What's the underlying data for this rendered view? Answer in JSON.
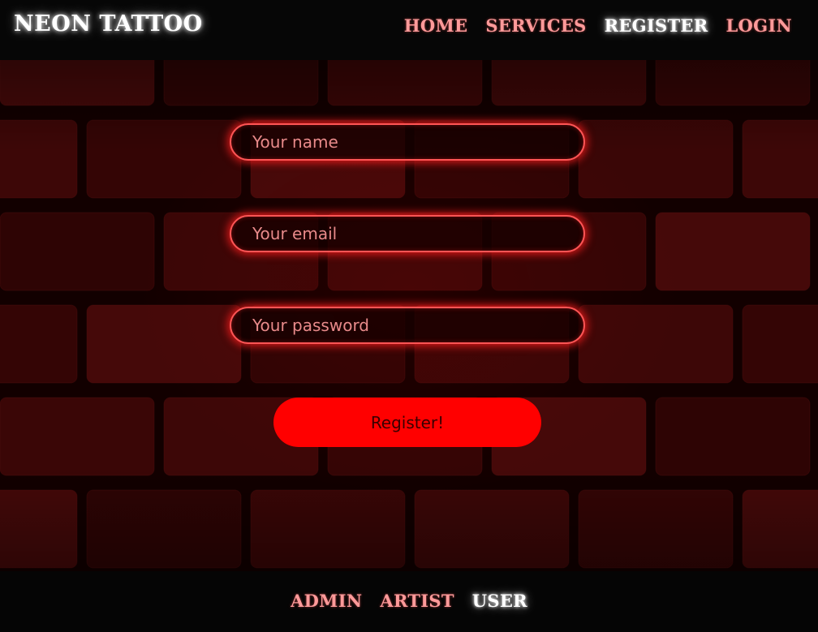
{
  "header": {
    "brand": "NEON TATTOO",
    "nav": [
      {
        "label": "HOME",
        "active": false
      },
      {
        "label": "SERVICES",
        "active": false
      },
      {
        "label": "REGISTER",
        "active": true
      },
      {
        "label": "LOGIN",
        "active": false
      }
    ]
  },
  "form": {
    "name_placeholder": "Your name",
    "email_placeholder": "Your email",
    "password_placeholder": "Your password",
    "submit_label": "Register!"
  },
  "footer": {
    "nav": [
      {
        "label": "ADMIN",
        "active": false
      },
      {
        "label": "ARTIST",
        "active": false
      },
      {
        "label": "USER",
        "active": true
      }
    ]
  },
  "colors": {
    "accent": "#ff0000",
    "link": "#ff9a9a",
    "active_link": "#ffffff",
    "header_bg": "#060606",
    "wall": "#3a0606"
  }
}
